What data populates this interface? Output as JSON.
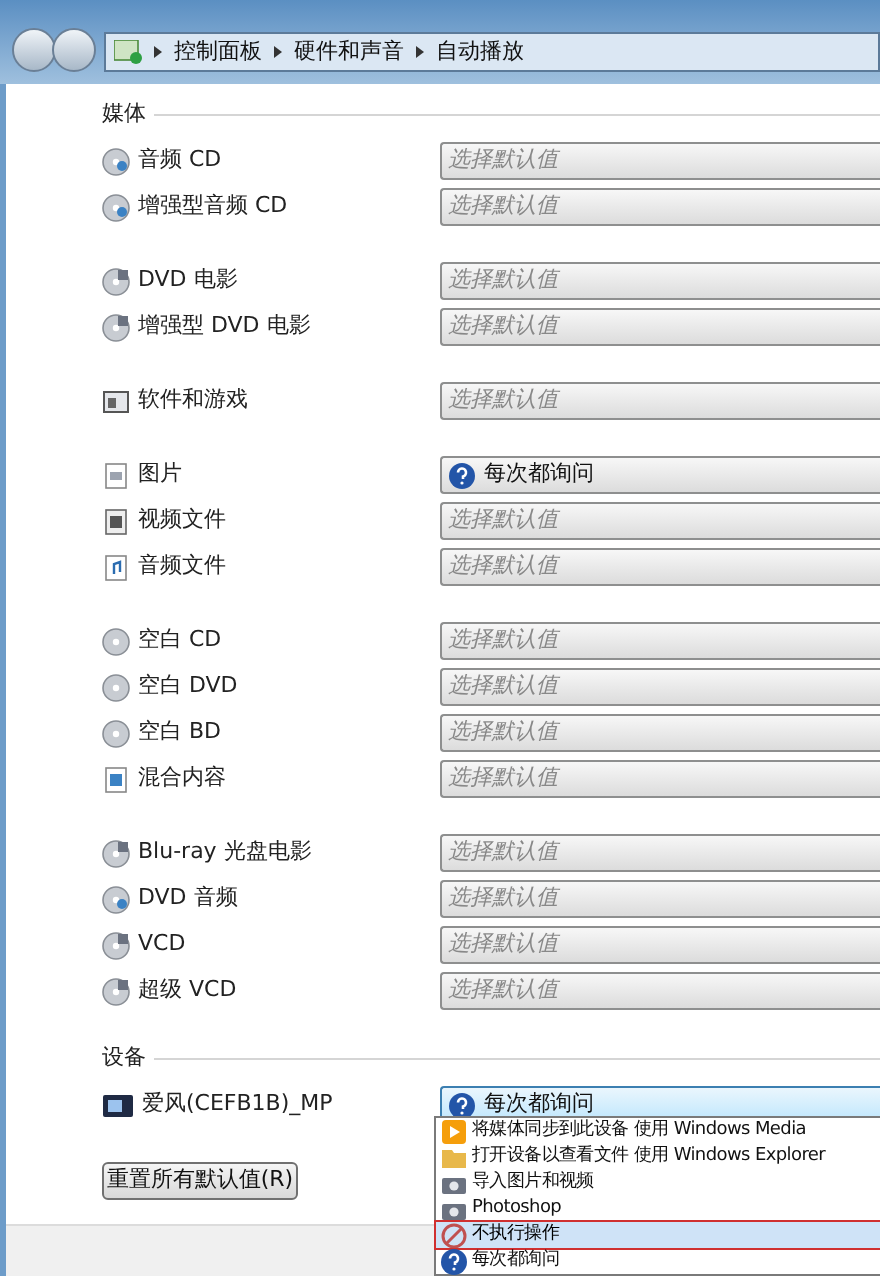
{
  "address_bar": {
    "crumbs": [
      "控制面板",
      "硬件和声音",
      "自动播放"
    ]
  },
  "sections": [
    {
      "title": "媒体",
      "groups": [
        [
          {
            "kind": "disc-audio",
            "label": "音频 CD",
            "choice": {
              "kind": "placeholder",
              "text": "选择默认值"
            }
          },
          {
            "kind": "disc-audio",
            "label": "增强型音频 CD",
            "choice": {
              "kind": "placeholder",
              "text": "选择默认值"
            }
          }
        ],
        [
          {
            "kind": "disc-video",
            "label": "DVD 电影",
            "choice": {
              "kind": "placeholder",
              "text": "选择默认值"
            }
          },
          {
            "kind": "disc-video",
            "label": "增强型 DVD 电影",
            "choice": {
              "kind": "placeholder",
              "text": "选择默认值"
            }
          }
        ],
        [
          {
            "kind": "software",
            "label": "软件和游戏",
            "choice": {
              "kind": "placeholder",
              "text": "选择默认值"
            }
          }
        ],
        [
          {
            "kind": "picture",
            "label": "图片",
            "choice": {
              "kind": "ask",
              "text": "每次都询问"
            }
          },
          {
            "kind": "video",
            "label": "视频文件",
            "choice": {
              "kind": "placeholder",
              "text": "选择默认值"
            }
          },
          {
            "kind": "audio",
            "label": "音频文件",
            "choice": {
              "kind": "placeholder",
              "text": "选择默认值"
            }
          }
        ],
        [
          {
            "kind": "disc-blank",
            "label": "空白 CD",
            "choice": {
              "kind": "placeholder",
              "text": "选择默认值"
            }
          },
          {
            "kind": "disc-blank",
            "label": "空白 DVD",
            "choice": {
              "kind": "placeholder",
              "text": "选择默认值"
            }
          },
          {
            "kind": "disc-blank",
            "label": "空白 BD",
            "choice": {
              "kind": "placeholder",
              "text": "选择默认值"
            }
          },
          {
            "kind": "mixed",
            "label": "混合内容",
            "choice": {
              "kind": "placeholder",
              "text": "选择默认值"
            }
          }
        ],
        [
          {
            "kind": "disc-video",
            "label": "Blu-ray 光盘电影",
            "choice": {
              "kind": "placeholder",
              "text": "选择默认值"
            }
          },
          {
            "kind": "disc-audio",
            "label": "DVD 音频",
            "choice": {
              "kind": "placeholder",
              "text": "选择默认值"
            }
          },
          {
            "kind": "disc-video",
            "label": "VCD",
            "choice": {
              "kind": "placeholder",
              "text": "选择默认值"
            }
          },
          {
            "kind": "disc-video",
            "label": "超级 VCD",
            "choice": {
              "kind": "placeholder",
              "text": "选择默认值"
            }
          }
        ]
      ]
    },
    {
      "title": "设备",
      "groups": [
        [
          {
            "kind": "device",
            "label": "爱风(CEFB1B)_MP",
            "choice": {
              "kind": "ask",
              "text": "每次都询问"
            },
            "expanded": true
          }
        ]
      ]
    }
  ],
  "dropdown_options": [
    {
      "kind": "media",
      "text": "将媒体同步到此设备 使用 Windows Media",
      "selected": false
    },
    {
      "kind": "folder",
      "text": "打开设备以查看文件 使用 Windows Explorer",
      "selected": false
    },
    {
      "kind": "camera",
      "text": "导入图片和视频",
      "selected": false
    },
    {
      "kind": "camera",
      "text": "Photoshop",
      "selected": false
    },
    {
      "kind": "none",
      "text": "不执行操作",
      "selected": true
    },
    {
      "kind": "ask",
      "text": "每次都询问",
      "selected": false
    }
  ],
  "reset_button": "重置所有默认值(R)"
}
